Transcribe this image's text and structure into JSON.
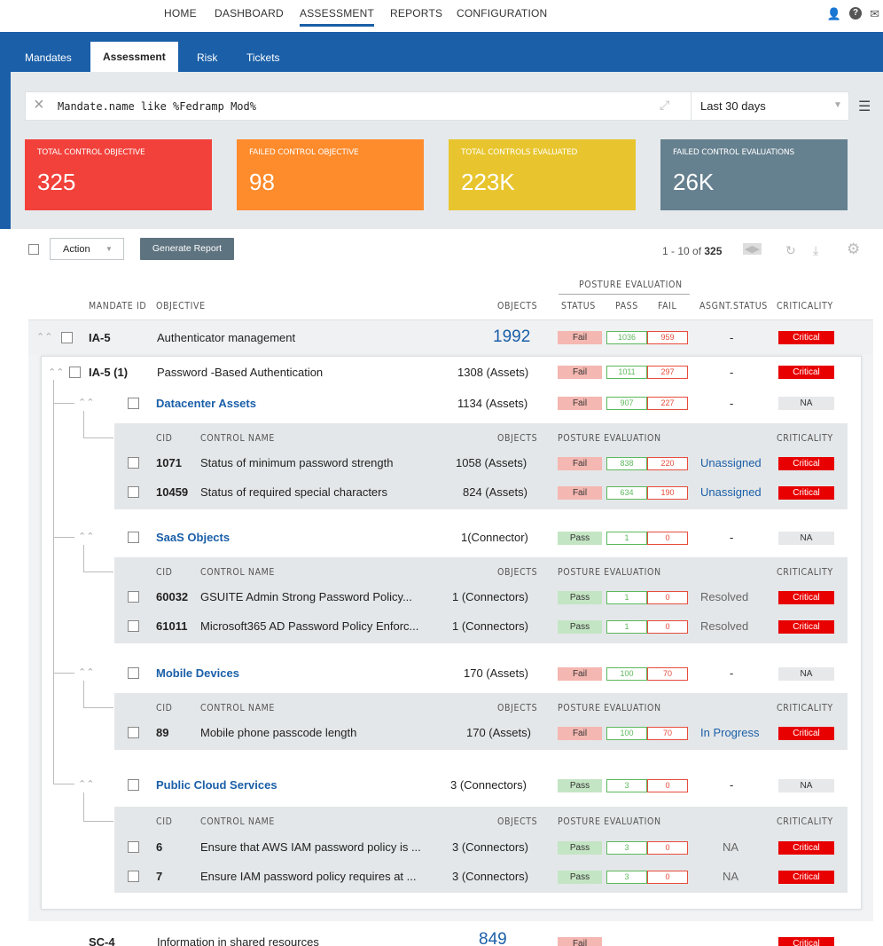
{
  "nav": {
    "home": "HOME",
    "dashboard": "DASHBOARD",
    "assessment": "ASSESSMENT",
    "reports": "REPORTS",
    "configuration": "CONFIGURATION"
  },
  "tabs": {
    "mandates": "Mandates",
    "assessment": "Assessment",
    "risk": "Risk",
    "tickets": "Tickets"
  },
  "filter": {
    "query": "Mandate.name like %Fedramp Mod%",
    "range": "Last 30 days"
  },
  "cards": [
    {
      "label": "TOTAL CONTROL OBJECTIVE",
      "value": "325",
      "color": "#f2413b"
    },
    {
      "label": "FAILED CONTROL OBJECTIVE",
      "value": "98",
      "color": "#fe8b2c"
    },
    {
      "label": "TOTAL CONTROLS EVALUATED",
      "value": "223K",
      "color": "#e8c52e"
    },
    {
      "label": "FAILED CONTROL EVALUATIONS",
      "value": "26K",
      "color": "#65808f"
    }
  ],
  "toolbar": {
    "action": "Action",
    "generate": "Generate Report",
    "pager_prefix": "1 - 10 of ",
    "pager_total": "325"
  },
  "headers": {
    "mandate_id": "MANDATE ID",
    "objective": "OBJECTIVE",
    "objects": "OBJECTS",
    "posture": "POSTURE EVALUATION",
    "status": "STATUS",
    "pass": "PASS",
    "fail": "FAIL",
    "asgnt": "ASGNT.STATUS",
    "criticality": "CRITICALITY",
    "cid": "CID",
    "control_name": "CONTROL NAME"
  },
  "main_row": {
    "id": "IA-5",
    "objective": "Authenticator management",
    "objects": "1992",
    "status": "Fail",
    "pass": "1036",
    "fail": "959",
    "asgnt": "-",
    "crit": "Critical"
  },
  "sub_row": {
    "id": "IA-5 (1)",
    "objective": "Password -Based Authentication",
    "objects": "1308 (Assets)",
    "status": "Fail",
    "pass": "1011",
    "fail": "297",
    "asgnt": "-",
    "crit": "Critical"
  },
  "groups": [
    {
      "name": "Datacenter Assets",
      "objects": "1134 (Assets)",
      "status": "Fail",
      "pass": "907",
      "fail": "227",
      "asgnt": "-",
      "crit": "NA",
      "controls": [
        {
          "cid": "1071",
          "name": "Status of minimum password strength",
          "objects": "1058 (Assets)",
          "status": "Fail",
          "pass": "838",
          "fail": "220",
          "asgnt": "Unassigned",
          "crit": "Critical"
        },
        {
          "cid": "10459",
          "name": "Status of required special characters",
          "objects": "824 (Assets)",
          "status": "Fail",
          "pass": "634",
          "fail": "190",
          "asgnt": "Unassigned",
          "crit": "Critical"
        }
      ]
    },
    {
      "name": "SaaS Objects",
      "objects": "1(Connector)",
      "status": "Pass",
      "pass": "1",
      "fail": "0",
      "asgnt": "-",
      "crit": "NA",
      "controls": [
        {
          "cid": "60032",
          "name": "GSUITE Admin Strong Password Policy...",
          "objects": "1 (Connectors)",
          "status": "Pass",
          "pass": "1",
          "fail": "0",
          "asgnt": "Resolved",
          "crit": "Critical"
        },
        {
          "cid": "61011",
          "name": "Microsoft365 AD Password Policy Enforc...",
          "objects": "1 (Connectors)",
          "status": "Pass",
          "pass": "1",
          "fail": "0",
          "asgnt": "Resolved",
          "crit": "Critical"
        }
      ]
    },
    {
      "name": "Mobile Devices",
      "objects": "170 (Assets)",
      "status": "Fail",
      "pass": "100",
      "fail": "70",
      "asgnt": "-",
      "crit": "NA",
      "controls": [
        {
          "cid": "89",
          "name": "Mobile phone passcode length",
          "objects": "170 (Assets)",
          "status": "Fail",
          "pass": "100",
          "fail": "70",
          "asgnt": "In Progress",
          "crit": "Critical"
        }
      ]
    },
    {
      "name": "Public Cloud Services",
      "objects": "3 (Connectors)",
      "status": "Pass",
      "pass": "3",
      "fail": "0",
      "asgnt": "-",
      "crit": "NA",
      "controls": [
        {
          "cid": "6",
          "name": "Ensure that AWS IAM password policy is ...",
          "objects": "3 (Connectors)",
          "status": "Pass",
          "pass": "3",
          "fail": "0",
          "asgnt": "NA",
          "crit": "Critical"
        },
        {
          "cid": "7",
          "name": "Ensure IAM password policy requires at ...",
          "objects": "3 (Connectors)",
          "status": "Pass",
          "pass": "3",
          "fail": "0",
          "asgnt": "NA",
          "crit": "Critical"
        }
      ]
    }
  ],
  "next_row": {
    "id": "SC-4",
    "objective": "Information in shared resources",
    "objects": "849",
    "status": "Fail",
    "crit": "Critical"
  }
}
